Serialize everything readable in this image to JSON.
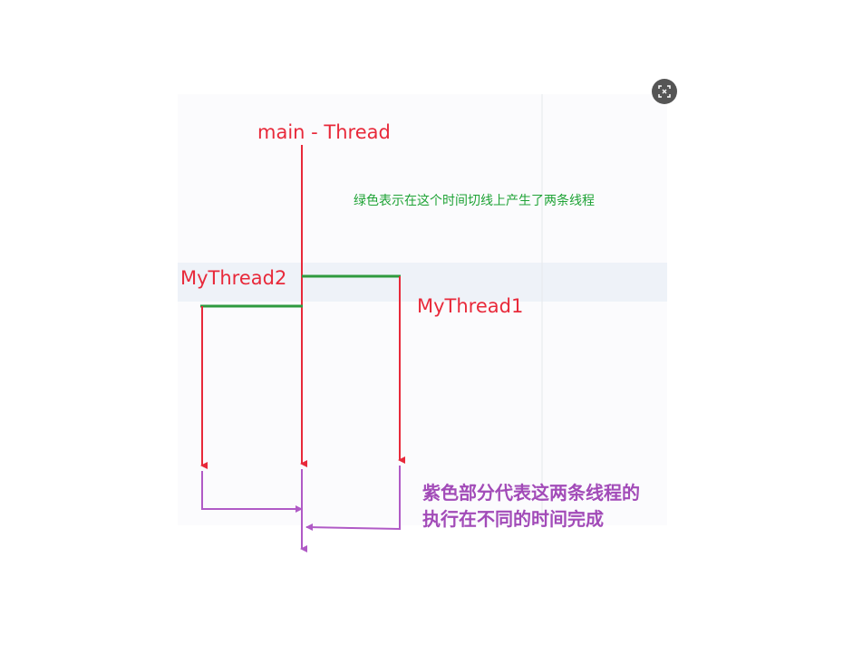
{
  "diagram": {
    "main_thread_label": "main - Thread",
    "thread1_label": "MyThread1",
    "thread2_label": "MyThread2",
    "green_note": "绿色表示在这个时间切线上产生了两条线程",
    "purple_note_line1": "紫色部分代表这两条线程的",
    "purple_note_line2": "执行在不同的时间完成"
  },
  "colors": {
    "thread_line": "#e8293a",
    "spawn_line": "#2e9a3e",
    "join_line": "#b05ac6",
    "green_text": "#1fa336",
    "purple_text": "#a24bb8"
  },
  "toolbar": {
    "fullscreen_icon": "expand-icon"
  }
}
